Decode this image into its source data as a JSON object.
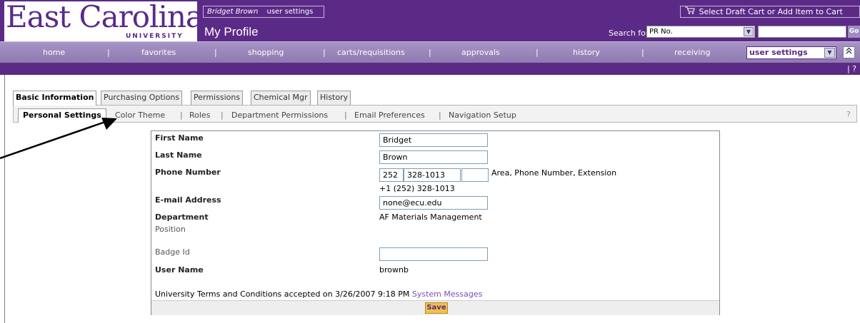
{
  "logo": {
    "word": "East Carolina",
    "sub": "UNIVERSITY"
  },
  "header": {
    "user_name": "Bridget Brown",
    "user_settings_link": "user settings",
    "page_title": "My Profile",
    "cart_label": "Select Draft Cart or Add Item to Cart",
    "cart_icon": "cart-icon",
    "search_label": "Search for",
    "search_type": "PR No.",
    "search_placeholder": "",
    "go_label": "Go"
  },
  "nav": {
    "items": [
      "home",
      "favorites",
      "shopping",
      "carts/requisitions",
      "approvals",
      "history",
      "receiving"
    ],
    "separator": "|",
    "settings_selected": "user settings",
    "collapse_icon": "double-chevron-up-icon",
    "help": "| ?"
  },
  "main_tabs": [
    "Basic Information",
    "Purchasing Options",
    "Permissions",
    "Chemical Mgr",
    "History"
  ],
  "sub_tabs": {
    "active": "Personal Settings",
    "items": [
      "Color Theme",
      "Roles",
      "Department Permissions",
      "Email Preferences",
      "Navigation Setup"
    ],
    "separator": "|",
    "help": "?"
  },
  "form": {
    "first_name_label": "First Name",
    "first_name": "Bridget",
    "last_name_label": "Last Name",
    "last_name": "Brown",
    "phone_label": "Phone Number",
    "phone_area": "252",
    "phone_number": "328-1013",
    "phone_ext": "",
    "phone_hint": "Area, Phone Number, Extension",
    "phone_formatted": "+1 (252) 328-1013",
    "email_label": "E-mail Address",
    "email": "none@ecu.edu",
    "department_label": "Department",
    "department": "AF Materials Management",
    "position_label": "Position",
    "badge_label": "Badge Id",
    "badge": "",
    "username_label": "User Name",
    "username": "brownb",
    "terms_text": "University Terms and Conditions accepted on 3/26/2007 9:18 PM",
    "system_messages_link": "System Messages",
    "save_label": "Save"
  },
  "colors": {
    "brand_purple": "#5b2a86",
    "nav_lavender": "#9c88bc",
    "save_gold": "#f2c14a",
    "link_purple": "#7a4fb5"
  }
}
